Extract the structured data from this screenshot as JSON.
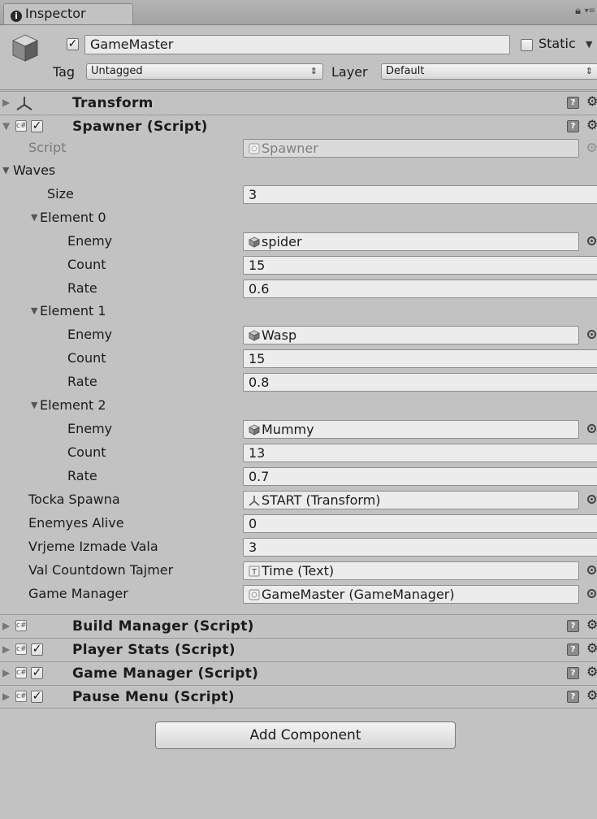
{
  "window": {
    "tab_label": "Inspector"
  },
  "header": {
    "object_name": "GameMaster",
    "static_label": "Static",
    "tag_label": "Tag",
    "tag_value": "Untagged",
    "layer_label": "Layer",
    "layer_value": "Default"
  },
  "components": {
    "transform": "Transform",
    "spawner": "Spawner (Script)",
    "build_manager": "Build Manager (Script)",
    "player_stats": "Player Stats (Script)",
    "game_manager": "Game Manager (Script)",
    "pause_menu": "Pause Menu (Script)"
  },
  "spawner": {
    "script_label": "Script",
    "script_value": "Spawner",
    "waves_label": "Waves",
    "size_label": "Size",
    "size_value": "3",
    "elements": [
      {
        "label": "Element 0",
        "enemy": "spider",
        "count": "15",
        "rate": "0.6"
      },
      {
        "label": "Element 1",
        "enemy": "Wasp",
        "count": "15",
        "rate": "0.8"
      },
      {
        "label": "Element 2",
        "enemy": "Mummy",
        "count": "13",
        "rate": "0.7"
      }
    ],
    "enemy_label": "Enemy",
    "count_label": "Count",
    "rate_label": "Rate",
    "tocka_spawna_label": "Tocka Spawna",
    "tocka_spawna_value": "START (Transform)",
    "enemyes_alive_label": "Enemyes Alive",
    "enemyes_alive_value": "0",
    "vrjeme_label": "Vrjeme Izmade Vala",
    "vrjeme_value": "3",
    "countdown_label": "Val Countdown Tajmer",
    "countdown_value": "Time (Text)",
    "game_manager_label": "Game Manager",
    "game_manager_value": "GameMaster (GameManager)"
  },
  "add_component_label": "Add Component"
}
